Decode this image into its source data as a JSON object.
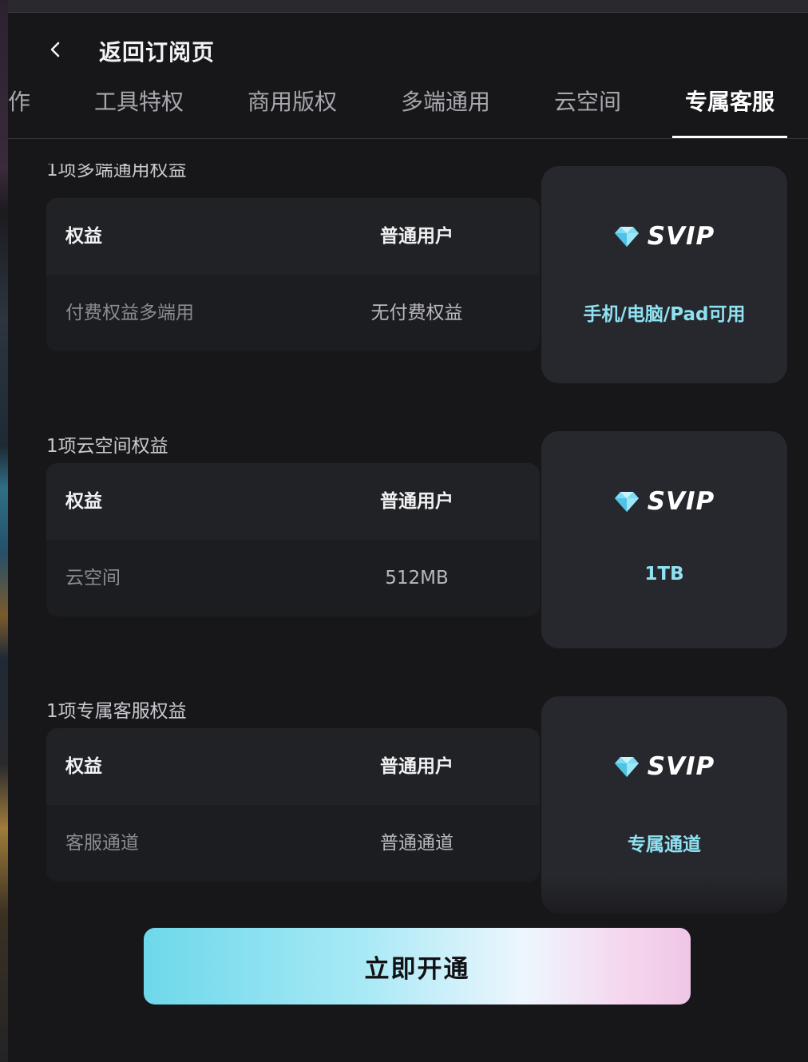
{
  "header": {
    "back_label": "返回订阅页"
  },
  "tabs": [
    {
      "label": "作",
      "active": false
    },
    {
      "label": "工具特权",
      "active": false
    },
    {
      "label": "商用版权",
      "active": false
    },
    {
      "label": "多端通用",
      "active": false
    },
    {
      "label": "云空间",
      "active": false
    },
    {
      "label": "专属客服",
      "active": true
    }
  ],
  "sections": [
    {
      "title": "1项多端通用权益",
      "header": {
        "col1": "权益",
        "col2": "普通用户"
      },
      "row": {
        "feature": "付费权益多端用",
        "normal": "无付费权益"
      },
      "svip": {
        "badge": "SVIP",
        "value": "手机/电脑/Pad可用"
      }
    },
    {
      "title": "1项云空间权益",
      "header": {
        "col1": "权益",
        "col2": "普通用户"
      },
      "row": {
        "feature": "云空间",
        "normal": "512MB"
      },
      "svip": {
        "badge": "SVIP",
        "value": "1TB"
      }
    },
    {
      "title": "1项专属客服权益",
      "header": {
        "col1": "权益",
        "col2": "普通用户"
      },
      "row": {
        "feature": "客服通道",
        "normal": "普通通道"
      },
      "svip": {
        "badge": "SVIP",
        "value": "专属通道"
      }
    }
  ],
  "cta": {
    "label": "立即开通"
  },
  "colors": {
    "background": "#17171a",
    "svip_value": "#8fe2f2",
    "cta_gradient_start": "#6dd8ea",
    "cta_gradient_end": "#efc6e6"
  }
}
